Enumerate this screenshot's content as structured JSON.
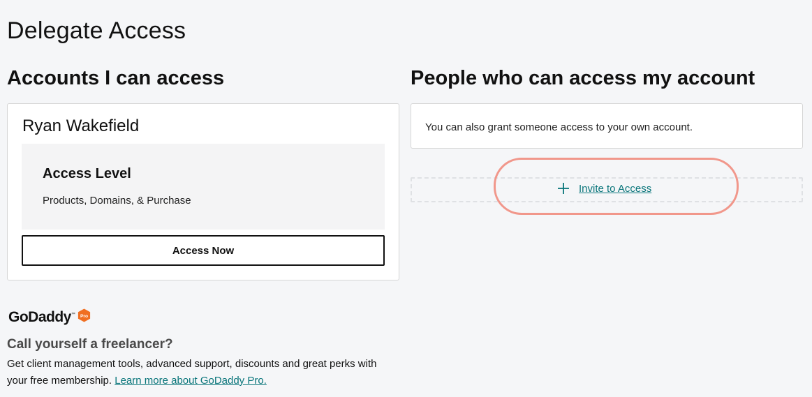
{
  "page": {
    "title": "Delegate Access"
  },
  "left": {
    "section_title": "Accounts I can access",
    "account": {
      "name": "Ryan Wakefield",
      "access_level_label": "Access Level",
      "access_level_value": "Products, Domains, & Purchase",
      "button_label": "Access Now"
    }
  },
  "right": {
    "section_title": "People who can access my account",
    "info_text": "You can also grant someone access to your own account.",
    "invite_label": "Invite to Access",
    "invite_icon": "plus-icon"
  },
  "promo": {
    "logo_text": "GoDaddy",
    "logo_tm": "™",
    "badge_text": "Pro",
    "heading": "Call yourself a freelancer?",
    "body_text": "Get client management tools, advanced support, discounts and great perks with your free membership. ",
    "link_text": "Learn more about GoDaddy Pro."
  },
  "colors": {
    "link": "#09757a",
    "highlight": "#f1978b",
    "badge": "#f06f22"
  }
}
